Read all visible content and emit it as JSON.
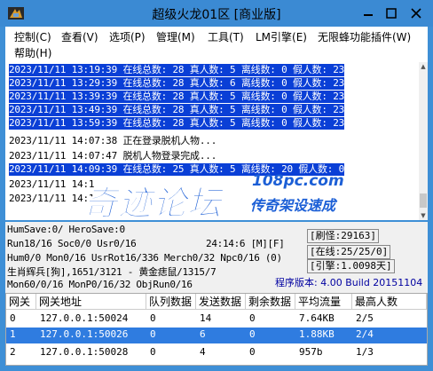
{
  "window": {
    "title": "超级火龙01区 [商业版]",
    "accent": "#3b8ad3"
  },
  "menu": [
    {
      "label": "控制(C)"
    },
    {
      "label": "查看(V)"
    },
    {
      "label": "选项(P)"
    },
    {
      "label": "管理(M)"
    },
    {
      "label": "工具(T)"
    },
    {
      "label": "LM引擎(E)"
    },
    {
      "label": "无限蜂功能插件(W)"
    },
    {
      "label": "帮助(H)"
    }
  ],
  "log": [
    {
      "text": "2023/11/11 13:19:39 在线总数: 28 真人数: 5 离线数: 0 假人数: 23",
      "highlight": true
    },
    {
      "text": "2023/11/11 13:29:39 在线总数: 28 真人数: 6 离线数: 0 假人数: 23",
      "highlight": true
    },
    {
      "text": "2023/11/11 13:39:39 在线总数: 28 真人数: 5 离线数: 0 假人数: 23",
      "highlight": true
    },
    {
      "text": "2023/11/11 13:49:39 在线总数: 28 真人数: 5 离线数: 0 假人数: 23",
      "highlight": true
    },
    {
      "text": "2023/11/11 13:59:39 在线总数: 28 真人数: 5 离线数: 0 假人数: 23",
      "highlight": true
    },
    {
      "text": "2023/11/11 14:07:38 正在登录脱机人物...",
      "highlight": false
    },
    {
      "text": "2023/11/11 14:07:47 脱机人物登录完成...",
      "highlight": false
    },
    {
      "text": "2023/11/11 14:09:39 在线总数: 25 真人数: 5 离线数: 20 假人数: 0",
      "highlight": true
    },
    {
      "text": "2023/11/11 14:1",
      "highlight": false
    },
    {
      "text": "2023/11/11 14:1",
      "highlight": false
    }
  ],
  "watermark": {
    "main": "奇迹论坛",
    "url": "108pc.com",
    "sub": "传奇架设速成"
  },
  "status": {
    "line1": "HumSave:0/ HeroSave:0",
    "line2": "Run18/16 Soc0/0 Usr0/16",
    "time": "24:14:6 [M][F]",
    "line3": "Hum0/0 Mon0/16 UsrRot16/336 Merch0/32 Npc0/16 (0)",
    "line4": "生肖辉兵[狗],1651/3121 - 黄金痣鼠/1315/7",
    "line5": "Mon60/0/16 MonP0/16/32 ObjRun0/16",
    "refresh": "[刷怪:29163]",
    "online": "[在线:25/25/0]",
    "explode": "[引擎:1.0098天]",
    "version": "程序版本: 4.00 Build 20151104"
  },
  "table": {
    "headers": [
      "网关",
      "网关地址",
      "队列数据",
      "发送数据",
      "剩余数据",
      "平均流量",
      "最高人数"
    ],
    "rows": [
      {
        "cells": [
          "0",
          "127.0.0.1:50024",
          "0",
          "14",
          "0",
          "7.64KB",
          "2/5"
        ],
        "selected": false
      },
      {
        "cells": [
          "1",
          "127.0.0.1:50026",
          "0",
          "6",
          "0",
          "1.88KB",
          "2/4"
        ],
        "selected": true
      },
      {
        "cells": [
          "2",
          "127.0.0.1:50028",
          "0",
          "4",
          "0",
          "957b",
          "1/3"
        ],
        "selected": false
      }
    ]
  }
}
